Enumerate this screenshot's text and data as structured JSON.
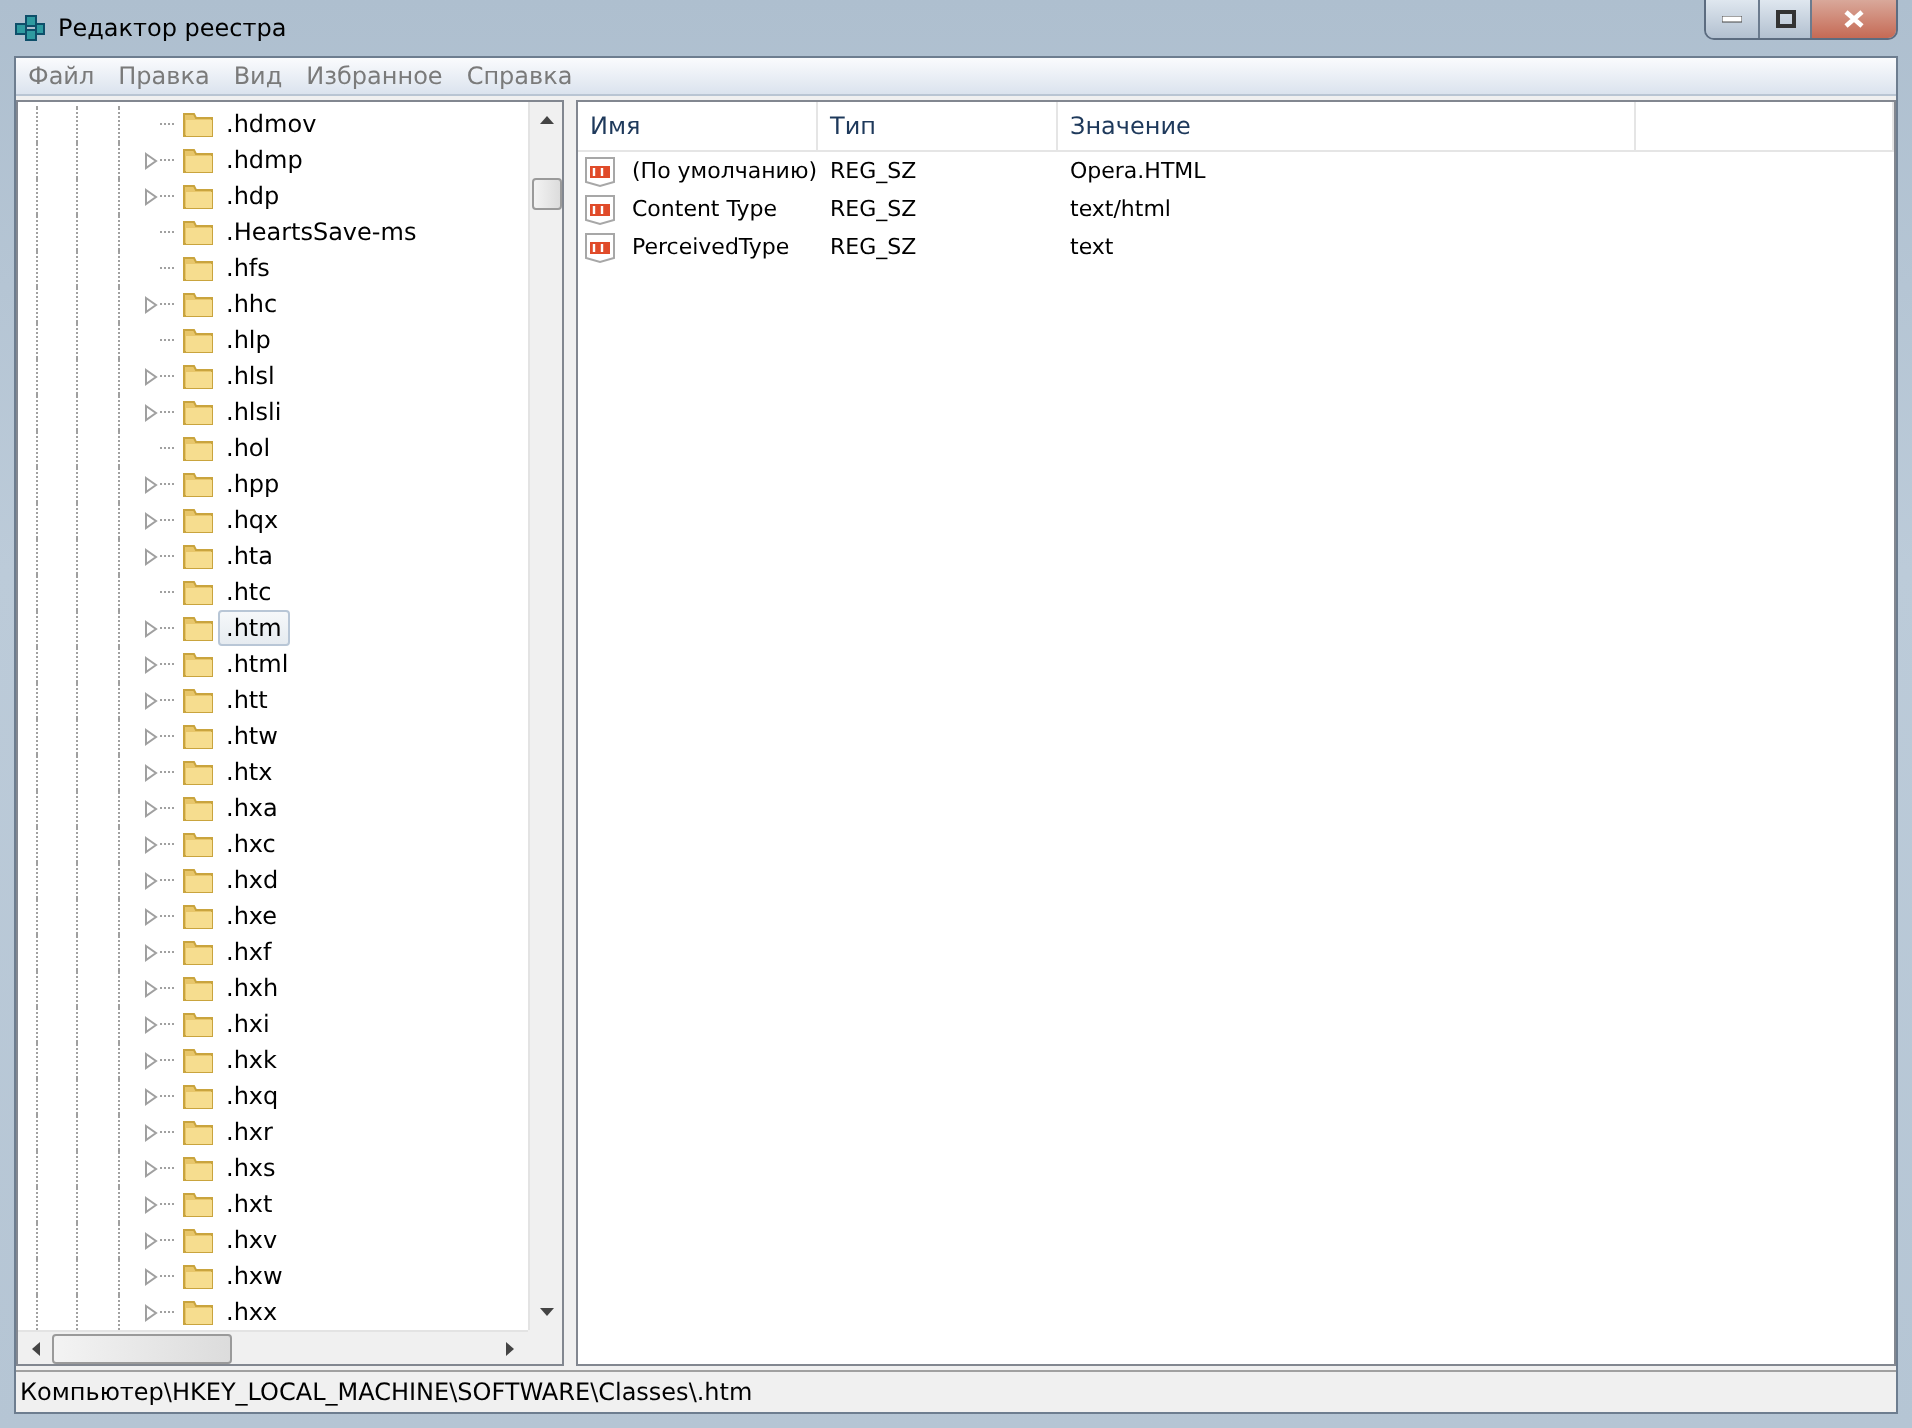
{
  "window": {
    "title": "Редактор реестра"
  },
  "menu": [
    "Файл",
    "Правка",
    "Вид",
    "Избранное",
    "Справка"
  ],
  "tree": {
    "items": [
      {
        "label": ".hdmov",
        "expandable": false,
        "selected": false
      },
      {
        "label": ".hdmp",
        "expandable": true,
        "selected": false
      },
      {
        "label": ".hdp",
        "expandable": true,
        "selected": false
      },
      {
        "label": ".HeartsSave-ms",
        "expandable": false,
        "selected": false
      },
      {
        "label": ".hfs",
        "expandable": false,
        "selected": false
      },
      {
        "label": ".hhc",
        "expandable": true,
        "selected": false
      },
      {
        "label": ".hlp",
        "expandable": false,
        "selected": false
      },
      {
        "label": ".hlsl",
        "expandable": true,
        "selected": false
      },
      {
        "label": ".hlsli",
        "expandable": true,
        "selected": false
      },
      {
        "label": ".hol",
        "expandable": false,
        "selected": false
      },
      {
        "label": ".hpp",
        "expandable": true,
        "selected": false
      },
      {
        "label": ".hqx",
        "expandable": true,
        "selected": false
      },
      {
        "label": ".hta",
        "expandable": true,
        "selected": false
      },
      {
        "label": ".htc",
        "expandable": false,
        "selected": false
      },
      {
        "label": ".htm",
        "expandable": true,
        "selected": true
      },
      {
        "label": ".html",
        "expandable": true,
        "selected": false
      },
      {
        "label": ".htt",
        "expandable": true,
        "selected": false
      },
      {
        "label": ".htw",
        "expandable": true,
        "selected": false
      },
      {
        "label": ".htx",
        "expandable": true,
        "selected": false
      },
      {
        "label": ".hxa",
        "expandable": true,
        "selected": false
      },
      {
        "label": ".hxc",
        "expandable": true,
        "selected": false
      },
      {
        "label": ".hxd",
        "expandable": true,
        "selected": false
      },
      {
        "label": ".hxe",
        "expandable": true,
        "selected": false
      },
      {
        "label": ".hxf",
        "expandable": true,
        "selected": false
      },
      {
        "label": ".hxh",
        "expandable": true,
        "selected": false
      },
      {
        "label": ".hxi",
        "expandable": true,
        "selected": false
      },
      {
        "label": ".hxk",
        "expandable": true,
        "selected": false
      },
      {
        "label": ".hxq",
        "expandable": true,
        "selected": false
      },
      {
        "label": ".hxr",
        "expandable": true,
        "selected": false
      },
      {
        "label": ".hxs",
        "expandable": true,
        "selected": false
      },
      {
        "label": ".hxt",
        "expandable": true,
        "selected": false
      },
      {
        "label": ".hxv",
        "expandable": true,
        "selected": false
      },
      {
        "label": ".hxw",
        "expandable": true,
        "selected": false
      },
      {
        "label": ".hxx",
        "expandable": true,
        "selected": false
      }
    ]
  },
  "table": {
    "columns": [
      "Имя",
      "Тип",
      "Значение"
    ],
    "rows": [
      {
        "name": "(По умолчанию)",
        "type": "REG_SZ",
        "value": "Opera.HTML"
      },
      {
        "name": "Content Type",
        "type": "REG_SZ",
        "value": "text/html"
      },
      {
        "name": "PerceivedType",
        "type": "REG_SZ",
        "value": "text"
      }
    ]
  },
  "status_bar": "Компьютер\\HKEY_LOCAL_MACHINE\\SOFTWARE\\Classes\\.htm"
}
